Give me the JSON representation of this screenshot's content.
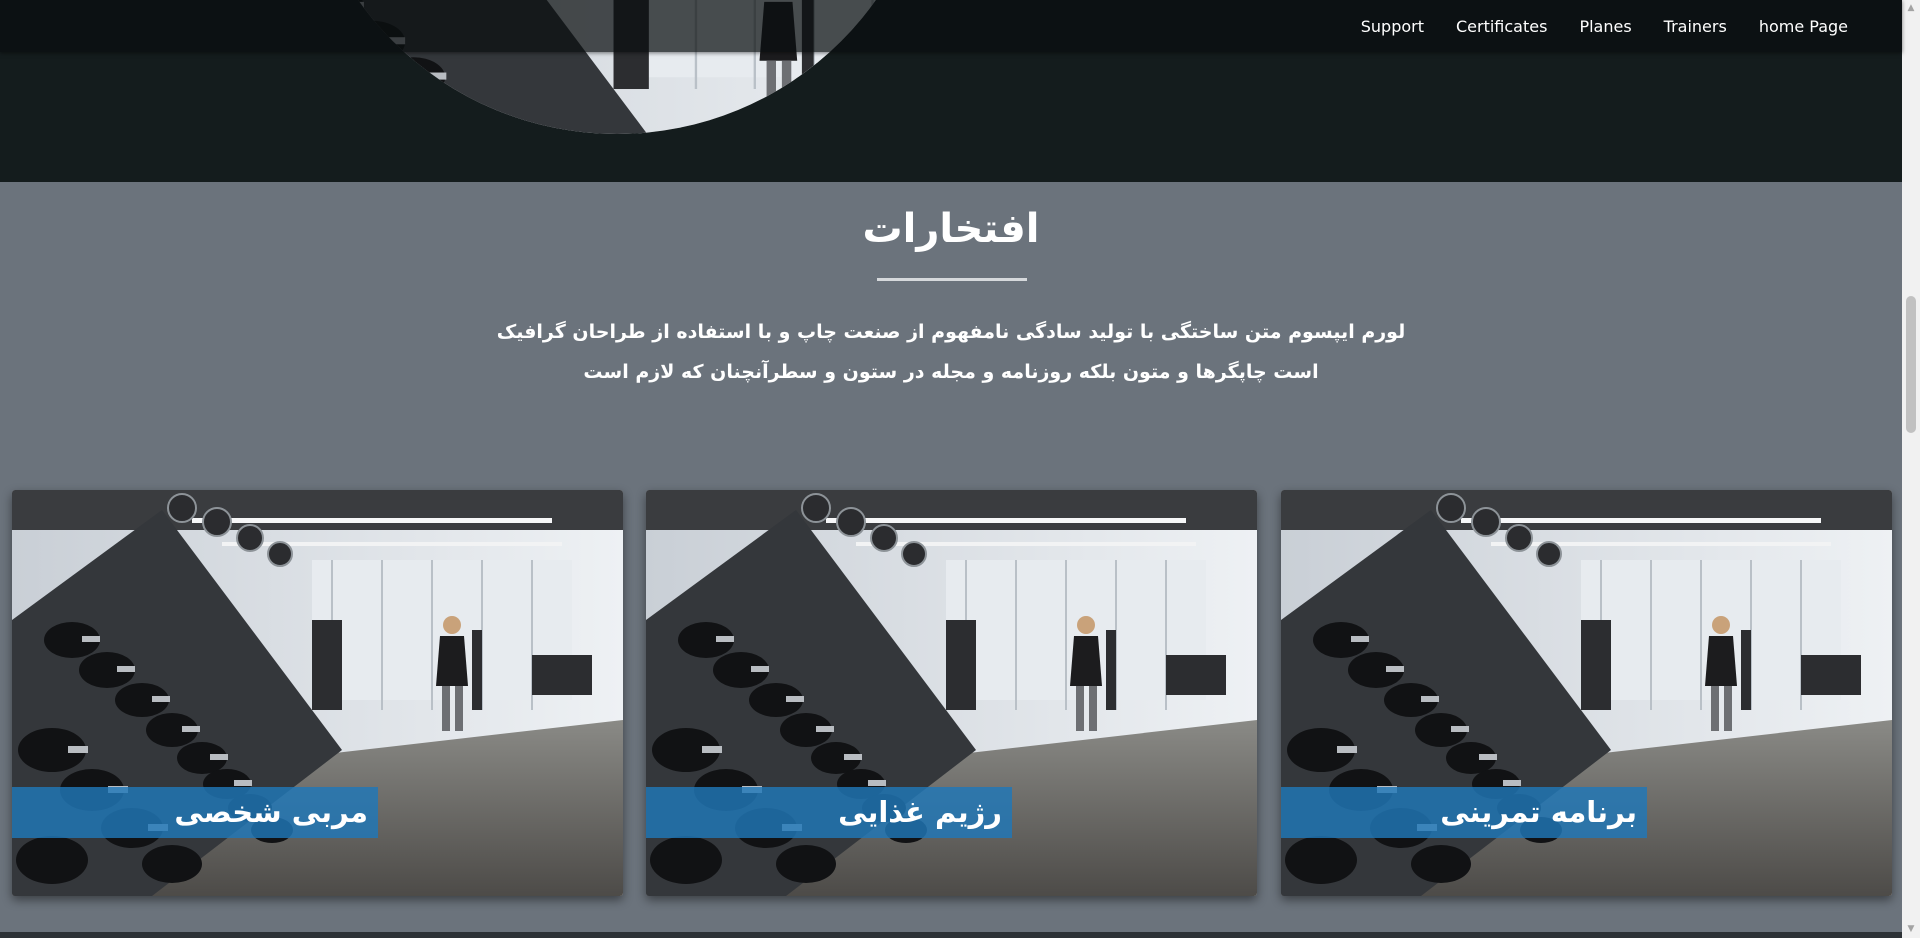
{
  "navbar": {
    "links": [
      {
        "label": "Support"
      },
      {
        "label": "Certificates"
      },
      {
        "label": "Planes"
      },
      {
        "label": "Trainers"
      },
      {
        "label": "home Page"
      }
    ]
  },
  "section": {
    "title": "افتخارات",
    "description": "لورم ایپسوم متن ساختگی با تولید سادگی نامفهوم از صنعت چاپ و با استفاده از طراحان گرافیک است چاپگرها و متون بلکه روزنامه و مجله در ستون و سطرآنچنان که لازم است"
  },
  "cards": [
    {
      "label": "مربی شخصی",
      "image": "gym-dumbbell-rack-photo"
    },
    {
      "label": "رژیم غذایی",
      "image": "gym-dumbbell-rack-photo"
    },
    {
      "label": "برنامه تمرینی",
      "image": "gym-dumbbell-rack-photo"
    }
  ],
  "colors": {
    "hero_background": "#141c1d",
    "section_background": "#6b737c",
    "card_label_background": "#2078b8",
    "text": "#ffffff"
  }
}
